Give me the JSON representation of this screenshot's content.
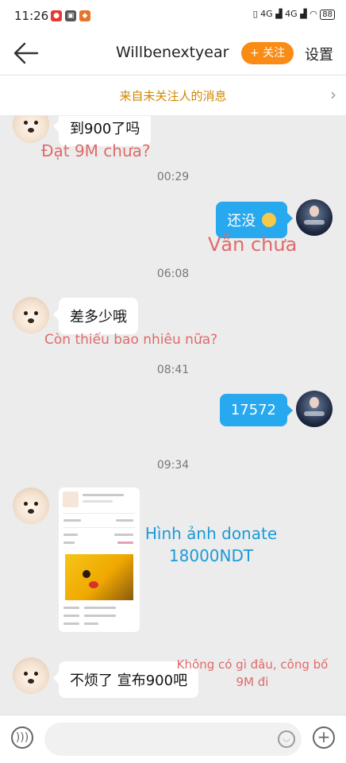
{
  "status_bar": {
    "time": "11:26",
    "network": "4G",
    "network2": "4G",
    "battery": "88"
  },
  "header": {
    "title": "Willbenextyear",
    "follow_label": "+ 关注",
    "settings_label": "设置"
  },
  "notice": {
    "text": "来自未关注人的消息"
  },
  "messages": [
    {
      "side": "left",
      "text": "到900了吗",
      "annotation": "Đạt 9M chưa?"
    },
    {
      "timestamp": "00:29"
    },
    {
      "side": "right",
      "text": "还没",
      "annotation": "Vẫn chưa"
    },
    {
      "timestamp": "06:08"
    },
    {
      "side": "left",
      "text": "差多少哦",
      "annotation": "Còn thiếu bao nhiêu nữa?"
    },
    {
      "timestamp": "08:41"
    },
    {
      "side": "right",
      "text": "17572"
    },
    {
      "timestamp": "09:34"
    },
    {
      "side": "left",
      "type": "image",
      "annotation_line1": "Hình ảnh donate",
      "annotation_line2": "18000NDT"
    },
    {
      "side": "left",
      "text": "不烦了 宣布900吧",
      "annotation_line1": "Không có gì đâu, công bố",
      "annotation_line2": "9M đi"
    }
  ],
  "input_bar": {
    "placeholder": ""
  },
  "icons": {
    "back": "arrow-left-icon",
    "voice": "voice-icon",
    "emoji": "emoji-icon",
    "add": "plus-circle-icon",
    "chevron": "chevron-right-icon"
  },
  "colors": {
    "accent": "#fa8c16",
    "bubble_me": "#28a8ee",
    "annotation": "#e06a6a",
    "annotation_blue": "#1a9ad8"
  }
}
